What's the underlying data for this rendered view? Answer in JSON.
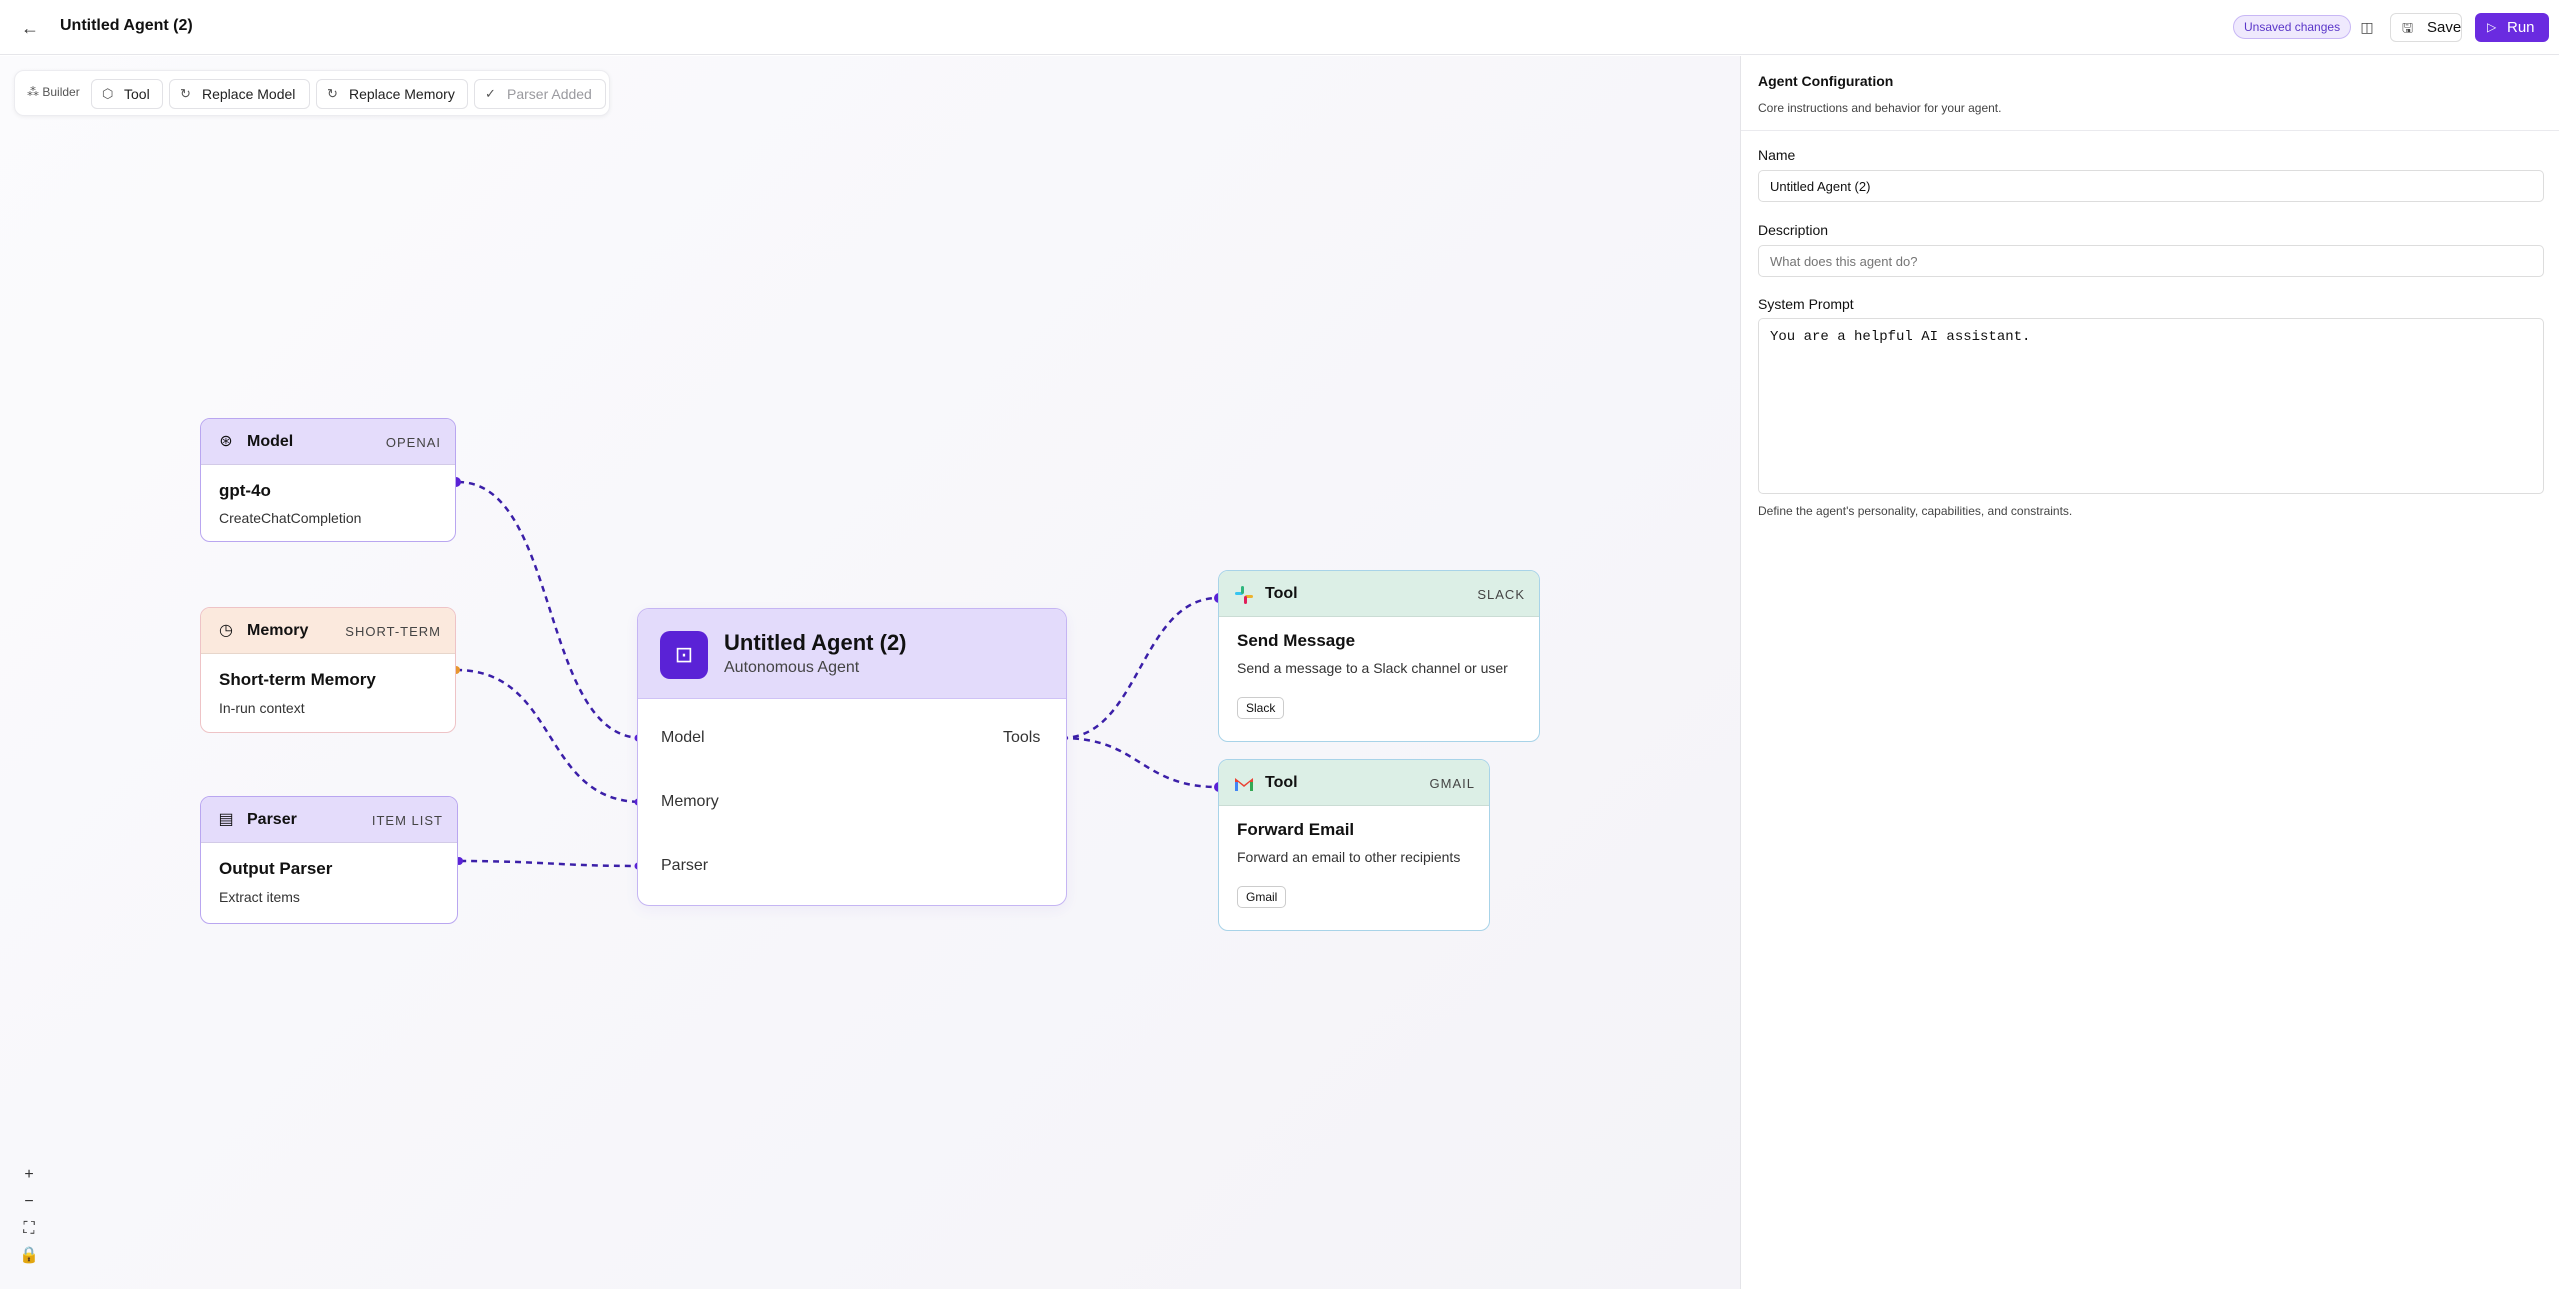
{
  "header": {
    "back_icon": "arrow-left-icon",
    "title": "Untitled Agent (2)",
    "unsaved": "Unsaved changes",
    "save_label": "Save",
    "run_label": "Run"
  },
  "toolbar": {
    "builder_label": "Builder",
    "tool": "Tool",
    "replace_model": "Replace Model",
    "replace_memory": "Replace Memory",
    "parser_added": "Parser Added"
  },
  "nodes": {
    "model": {
      "type": "Model",
      "tag": "OPENAI",
      "name": "gpt-4o",
      "sub": "CreateChatCompletion"
    },
    "memory": {
      "type": "Memory",
      "tag": "SHORT-TERM",
      "name": "Short-term Memory",
      "sub": "In-run context"
    },
    "parser": {
      "type": "Parser",
      "tag": "ITEM LIST",
      "name": "Output Parser",
      "sub": "Extract items"
    },
    "agent": {
      "title": "Untitled Agent (2)",
      "subtitle": "Autonomous Agent",
      "port_model": "Model",
      "port_memory": "Memory",
      "port_parser": "Parser",
      "port_tools": "Tools"
    },
    "slack": {
      "type": "Tool",
      "tag": "SLACK",
      "name": "Send Message",
      "sub": "Send a message to a Slack channel or user",
      "pill": "Slack"
    },
    "gmail": {
      "type": "Tool",
      "tag": "GMAIL",
      "name": "Forward Email",
      "sub": "Forward an email to other recipients",
      "pill": "Gmail"
    }
  },
  "panel": {
    "title": "Agent Configuration",
    "subtitle": "Core instructions and behavior for your agent.",
    "name_label": "Name",
    "name_value": "Untitled Agent (2)",
    "description_label": "Description",
    "description_placeholder": "What does this agent do?",
    "prompt_label": "System Prompt",
    "prompt_value": "You are a helpful AI assistant.",
    "prompt_hint": "Define the agent's personality, capabilities, and constraints."
  },
  "colors": {
    "accent": "#6a2be0",
    "edge": "#3b1fa8",
    "memory_port": "#e8962e"
  }
}
